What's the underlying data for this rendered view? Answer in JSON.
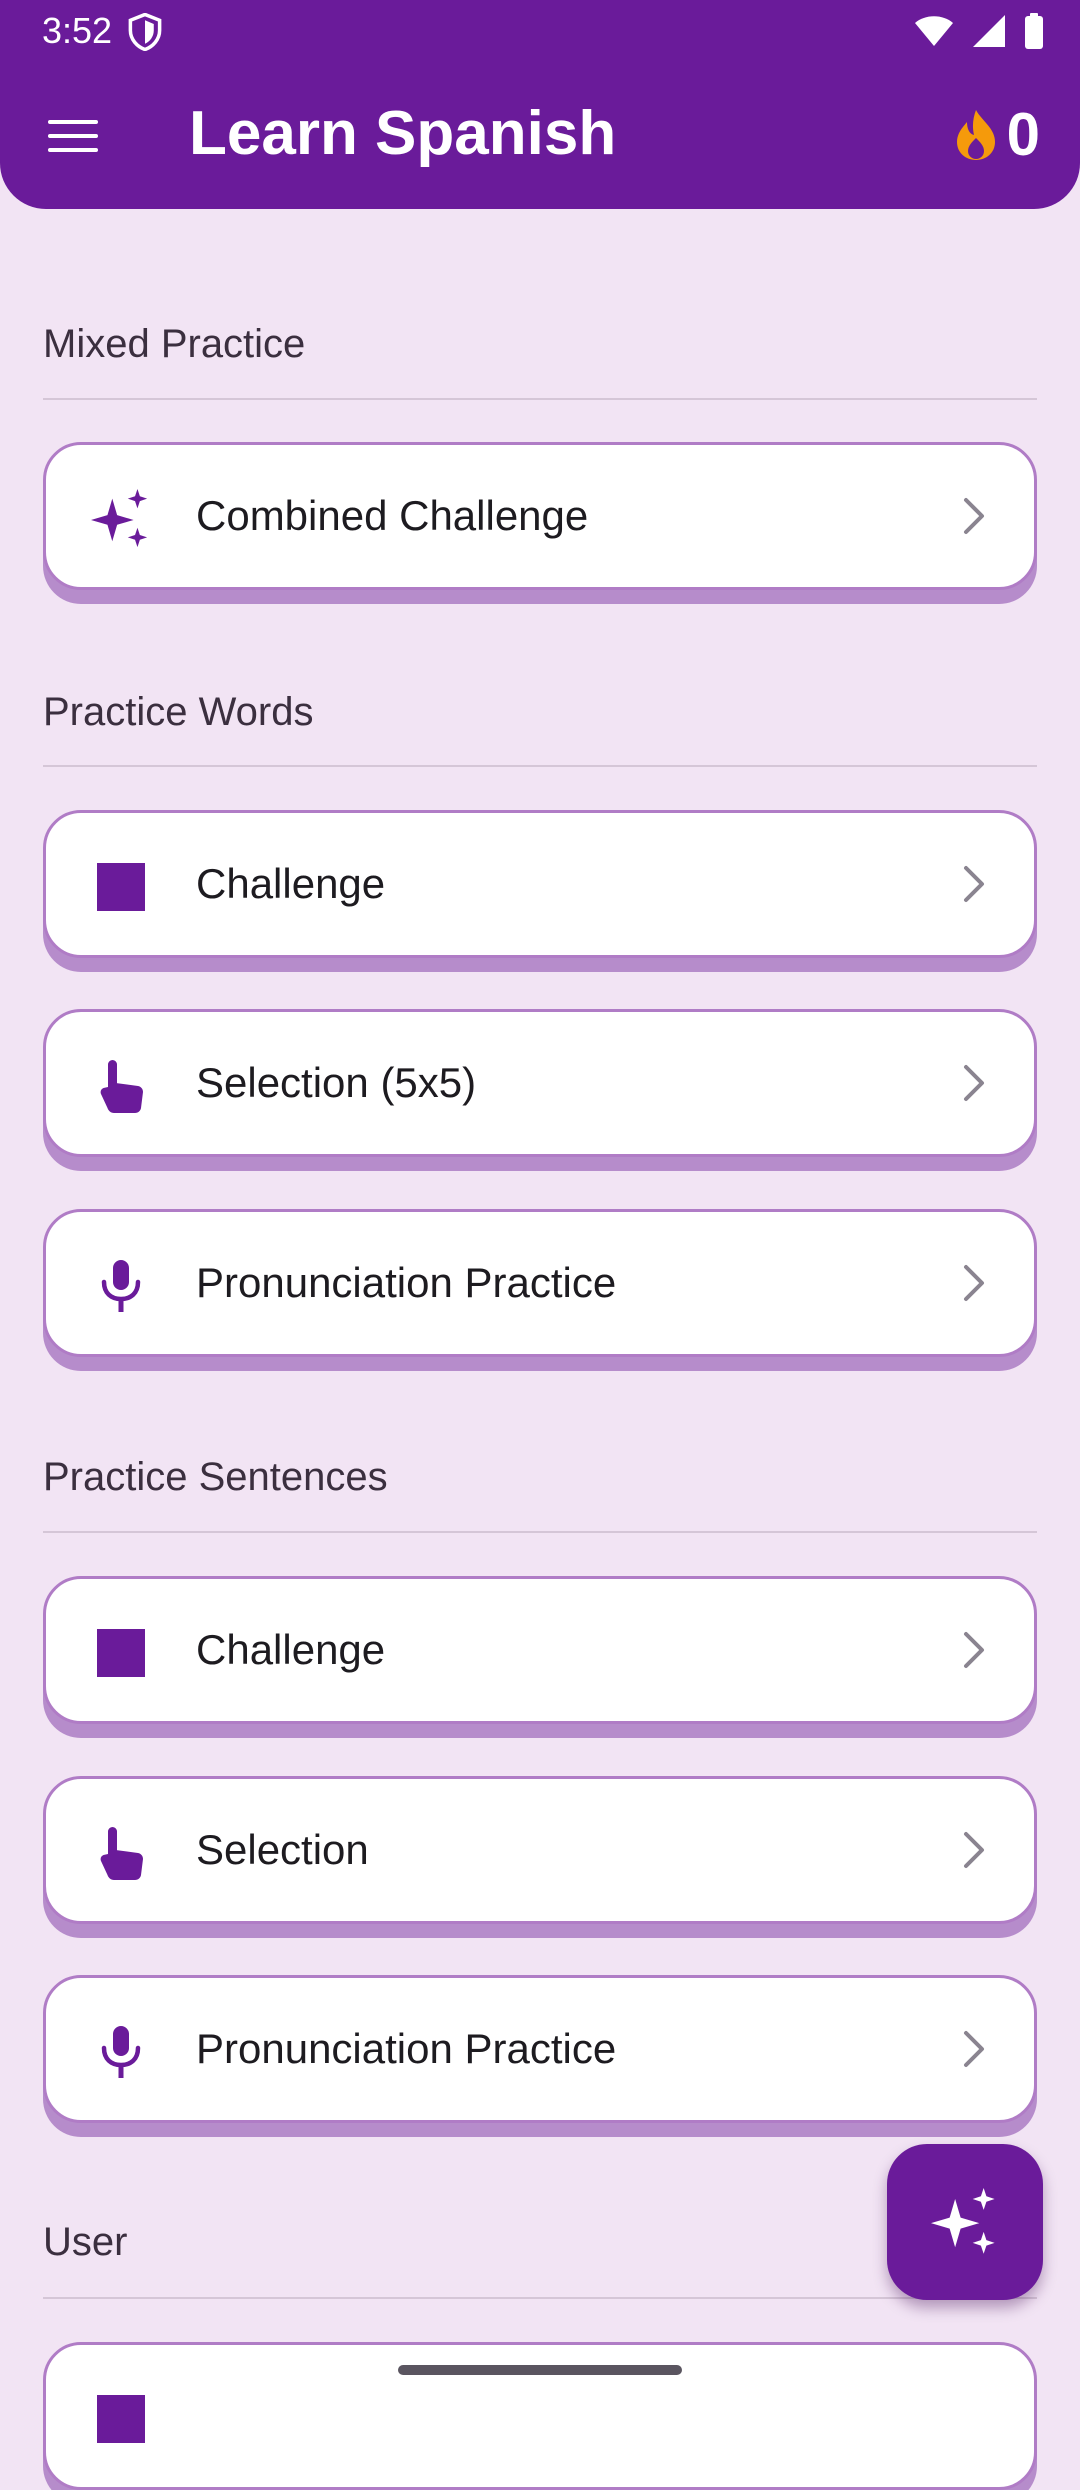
{
  "status_bar": {
    "time": "3:52"
  },
  "header": {
    "title": "Learn Spanish",
    "streak_count": "0"
  },
  "sections": {
    "mixed": {
      "title": "Mixed Practice",
      "items": [
        {
          "label": "Combined Challenge",
          "icon": "sparkle-icon"
        }
      ]
    },
    "words": {
      "title": "Practice Words",
      "items": [
        {
          "label": "Challenge",
          "icon": "square-icon"
        },
        {
          "label": "Selection (5x5)",
          "icon": "touch-icon"
        },
        {
          "label": "Pronunciation Practice",
          "icon": "microphone-icon"
        }
      ]
    },
    "sentences": {
      "title": "Practice Sentences",
      "items": [
        {
          "label": "Challenge",
          "icon": "square-icon"
        },
        {
          "label": "Selection",
          "icon": "touch-icon"
        },
        {
          "label": "Pronunciation Practice",
          "icon": "microphone-icon"
        }
      ]
    },
    "user": {
      "title": "User"
    }
  },
  "colors": {
    "primary": "#6a1b9a",
    "background": "#f2e4f4",
    "card_border": "#b07cc6",
    "streak_flame": "#f59a0b"
  },
  "fab": {
    "icon": "sparkle-icon"
  }
}
